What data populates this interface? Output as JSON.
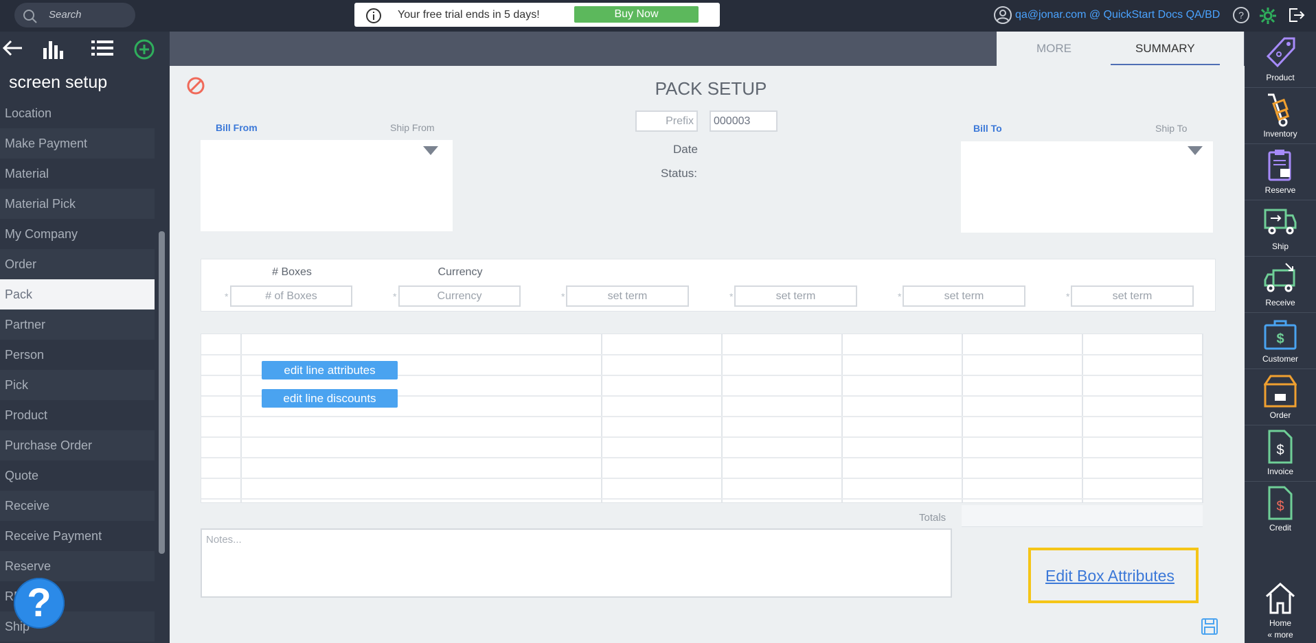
{
  "topbar": {
    "search_placeholder": "Search",
    "trial_text": "Your free trial ends in 5 days!",
    "buy_label": "Buy Now",
    "user_text": "qa@jonar.com @ QuickStart Docs QA/BD"
  },
  "sidebar": {
    "title": "screen setup",
    "items": [
      {
        "label": "Location"
      },
      {
        "label": "Make Payment"
      },
      {
        "label": "Material"
      },
      {
        "label": "Material Pick"
      },
      {
        "label": "My Company"
      },
      {
        "label": "Order"
      },
      {
        "label": "Pack"
      },
      {
        "label": "Partner"
      },
      {
        "label": "Person"
      },
      {
        "label": "Pick"
      },
      {
        "label": "Product"
      },
      {
        "label": "Purchase Order"
      },
      {
        "label": "Quote"
      },
      {
        "label": "Receive"
      },
      {
        "label": "Receive Payment"
      },
      {
        "label": "Reserve"
      },
      {
        "label": "RMA"
      },
      {
        "label": "Ship"
      }
    ],
    "active": "Pack",
    "help_label": "?"
  },
  "tabs": {
    "more": "MORE",
    "summary": "SUMMARY"
  },
  "form": {
    "title": "PACK SETUP",
    "bill_from": "Bill From",
    "ship_from": "Ship From",
    "bill_to": "Bill To",
    "ship_to": "Ship To",
    "prefix_placeholder": "Prefix",
    "number_value": "000003",
    "date_label": "Date",
    "status_label": "Status:",
    "boxes_label": "# Boxes",
    "currency_label": "Currency",
    "boxes_placeholder": "# of Boxes",
    "currency_placeholder": "Currency",
    "term_placeholder": "set term",
    "required_mark": "*",
    "edit_line_attributes": "edit line attributes",
    "edit_line_discounts": "edit line discounts",
    "totals_label": "Totals",
    "notes_placeholder": "Notes...",
    "edit_box_attributes": "Edit Box Attributes"
  },
  "right_sidebar": {
    "items": [
      {
        "label": "Product",
        "icon": "tag-icon",
        "color": "#a78bfa"
      },
      {
        "label": "Inventory",
        "icon": "hand-truck-icon",
        "color": "#f0a030"
      },
      {
        "label": "Reserve",
        "icon": "clipboard-box-icon",
        "color": "#a78bfa"
      },
      {
        "label": "Ship",
        "icon": "truck-out-icon",
        "color": "#6fcf97"
      },
      {
        "label": "Receive",
        "icon": "truck-in-icon",
        "color": "#6fcf97"
      },
      {
        "label": "Customer",
        "icon": "briefcase-dollar-icon",
        "color": "#4aa3f0"
      },
      {
        "label": "Order",
        "icon": "package-icon",
        "color": "#f0a030"
      },
      {
        "label": "Invoice",
        "icon": "invoice-icon",
        "color": "#6fcf97"
      },
      {
        "label": "Credit",
        "icon": "credit-note-icon",
        "color": "#6fcf97"
      },
      {
        "label": "Home",
        "icon": "home-icon",
        "color": "#ffffff"
      }
    ],
    "more_label": "« more"
  }
}
